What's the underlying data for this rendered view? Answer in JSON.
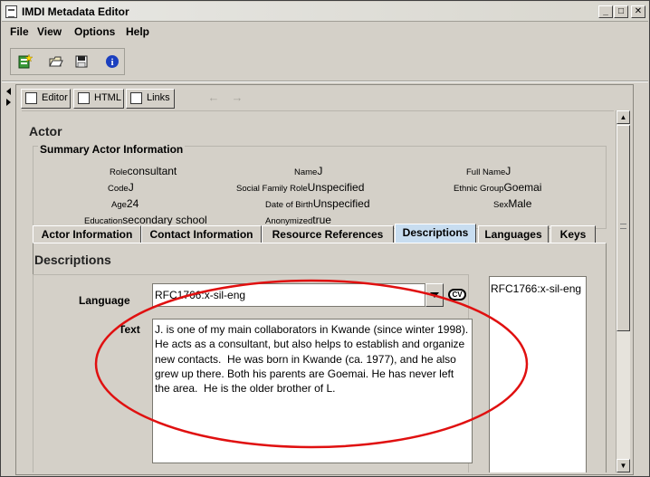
{
  "window": {
    "title": "IMDI Metadata Editor"
  },
  "menu": {
    "file": "File",
    "view": "View",
    "options": "Options",
    "help": "Help"
  },
  "toolbar": {
    "new_icon": "new-icon",
    "open_icon": "open-icon",
    "save_icon": "save-icon",
    "info_icon": "info-icon"
  },
  "subtabs": {
    "editor": "Editor",
    "html": "HTML",
    "links": "Links"
  },
  "actor": {
    "title": "Actor",
    "summary_title": "Summary Actor Information",
    "fields": {
      "role_label": "Role",
      "role": "consultant",
      "name_label": "Name",
      "name": "J",
      "full_name_label": "Full Name",
      "full_name": "J",
      "code_label": "Code",
      "code": "J",
      "social_label": "Social Family Role",
      "social": "Unspecified",
      "ethnic_label": "Ethnic Group",
      "ethnic": "Goemai",
      "age_label": "Age",
      "age": "24",
      "dob_label": "Date of Birth",
      "dob": "Unspecified",
      "sex_label": "Sex",
      "sex": "Male",
      "education_label": "Education",
      "education": "secondary school",
      "anon_label": "Anonymized",
      "anon": "true"
    }
  },
  "tabs": [
    {
      "label": "Actor Information"
    },
    {
      "label": "Contact Information"
    },
    {
      "label": "Resource References"
    },
    {
      "label": "Descriptions",
      "active": true
    },
    {
      "label": "Languages"
    },
    {
      "label": "Keys"
    }
  ],
  "descriptions": {
    "title": "Descriptions",
    "language_label": "Language",
    "language_value": "RFC1766:x-sil-eng",
    "cv_label": "CV",
    "text_label": "Text",
    "text_value": "J. is one of my main collaborators in Kwande (since winter 1998). He acts as a consultant, but also helps to establish and organize new contacts.  He was born in Kwande (ca. 1977), and he also grew up there. Both his parents are Goemai. He has never left the area.  He is the older brother of L.",
    "language_list": [
      "RFC1766:x-sil-eng"
    ]
  },
  "annotation": {
    "color": "#e01010"
  }
}
